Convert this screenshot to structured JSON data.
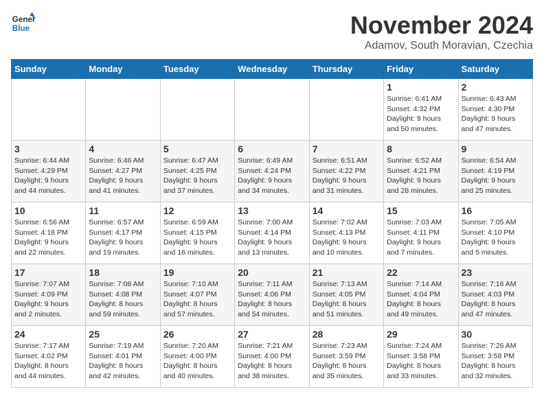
{
  "logo": {
    "line1": "General",
    "line2": "Blue"
  },
  "title": "November 2024",
  "location": "Adamov, South Moravian, Czechia",
  "weekdays": [
    "Sunday",
    "Monday",
    "Tuesday",
    "Wednesday",
    "Thursday",
    "Friday",
    "Saturday"
  ],
  "weeks": [
    [
      {
        "day": "",
        "info": ""
      },
      {
        "day": "",
        "info": ""
      },
      {
        "day": "",
        "info": ""
      },
      {
        "day": "",
        "info": ""
      },
      {
        "day": "",
        "info": ""
      },
      {
        "day": "1",
        "info": "Sunrise: 6:41 AM\nSunset: 4:32 PM\nDaylight: 9 hours\nand 50 minutes."
      },
      {
        "day": "2",
        "info": "Sunrise: 6:43 AM\nSunset: 4:30 PM\nDaylight: 9 hours\nand 47 minutes."
      }
    ],
    [
      {
        "day": "3",
        "info": "Sunrise: 6:44 AM\nSunset: 4:29 PM\nDaylight: 9 hours\nand 44 minutes."
      },
      {
        "day": "4",
        "info": "Sunrise: 6:46 AM\nSunset: 4:27 PM\nDaylight: 9 hours\nand 41 minutes."
      },
      {
        "day": "5",
        "info": "Sunrise: 6:47 AM\nSunset: 4:25 PM\nDaylight: 9 hours\nand 37 minutes."
      },
      {
        "day": "6",
        "info": "Sunrise: 6:49 AM\nSunset: 4:24 PM\nDaylight: 9 hours\nand 34 minutes."
      },
      {
        "day": "7",
        "info": "Sunrise: 6:51 AM\nSunset: 4:22 PM\nDaylight: 9 hours\nand 31 minutes."
      },
      {
        "day": "8",
        "info": "Sunrise: 6:52 AM\nSunset: 4:21 PM\nDaylight: 9 hours\nand 28 minutes."
      },
      {
        "day": "9",
        "info": "Sunrise: 6:54 AM\nSunset: 4:19 PM\nDaylight: 9 hours\nand 25 minutes."
      }
    ],
    [
      {
        "day": "10",
        "info": "Sunrise: 6:56 AM\nSunset: 4:18 PM\nDaylight: 9 hours\nand 22 minutes."
      },
      {
        "day": "11",
        "info": "Sunrise: 6:57 AM\nSunset: 4:17 PM\nDaylight: 9 hours\nand 19 minutes."
      },
      {
        "day": "12",
        "info": "Sunrise: 6:59 AM\nSunset: 4:15 PM\nDaylight: 9 hours\nand 16 minutes."
      },
      {
        "day": "13",
        "info": "Sunrise: 7:00 AM\nSunset: 4:14 PM\nDaylight: 9 hours\nand 13 minutes."
      },
      {
        "day": "14",
        "info": "Sunrise: 7:02 AM\nSunset: 4:13 PM\nDaylight: 9 hours\nand 10 minutes."
      },
      {
        "day": "15",
        "info": "Sunrise: 7:03 AM\nSunset: 4:11 PM\nDaylight: 9 hours\nand 7 minutes."
      },
      {
        "day": "16",
        "info": "Sunrise: 7:05 AM\nSunset: 4:10 PM\nDaylight: 9 hours\nand 5 minutes."
      }
    ],
    [
      {
        "day": "17",
        "info": "Sunrise: 7:07 AM\nSunset: 4:09 PM\nDaylight: 9 hours\nand 2 minutes."
      },
      {
        "day": "18",
        "info": "Sunrise: 7:08 AM\nSunset: 4:08 PM\nDaylight: 8 hours\nand 59 minutes."
      },
      {
        "day": "19",
        "info": "Sunrise: 7:10 AM\nSunset: 4:07 PM\nDaylight: 8 hours\nand 57 minutes."
      },
      {
        "day": "20",
        "info": "Sunrise: 7:11 AM\nSunset: 4:06 PM\nDaylight: 8 hours\nand 54 minutes."
      },
      {
        "day": "21",
        "info": "Sunrise: 7:13 AM\nSunset: 4:05 PM\nDaylight: 8 hours\nand 51 minutes."
      },
      {
        "day": "22",
        "info": "Sunrise: 7:14 AM\nSunset: 4:04 PM\nDaylight: 8 hours\nand 49 minutes."
      },
      {
        "day": "23",
        "info": "Sunrise: 7:16 AM\nSunset: 4:03 PM\nDaylight: 8 hours\nand 47 minutes."
      }
    ],
    [
      {
        "day": "24",
        "info": "Sunrise: 7:17 AM\nSunset: 4:02 PM\nDaylight: 8 hours\nand 44 minutes."
      },
      {
        "day": "25",
        "info": "Sunrise: 7:19 AM\nSunset: 4:01 PM\nDaylight: 8 hours\nand 42 minutes."
      },
      {
        "day": "26",
        "info": "Sunrise: 7:20 AM\nSunset: 4:00 PM\nDaylight: 8 hours\nand 40 minutes."
      },
      {
        "day": "27",
        "info": "Sunrise: 7:21 AM\nSunset: 4:00 PM\nDaylight: 8 hours\nand 38 minutes."
      },
      {
        "day": "28",
        "info": "Sunrise: 7:23 AM\nSunset: 3:59 PM\nDaylight: 8 hours\nand 35 minutes."
      },
      {
        "day": "29",
        "info": "Sunrise: 7:24 AM\nSunset: 3:58 PM\nDaylight: 8 hours\nand 33 minutes."
      },
      {
        "day": "30",
        "info": "Sunrise: 7:26 AM\nSunset: 3:58 PM\nDaylight: 8 hours\nand 32 minutes."
      }
    ]
  ]
}
